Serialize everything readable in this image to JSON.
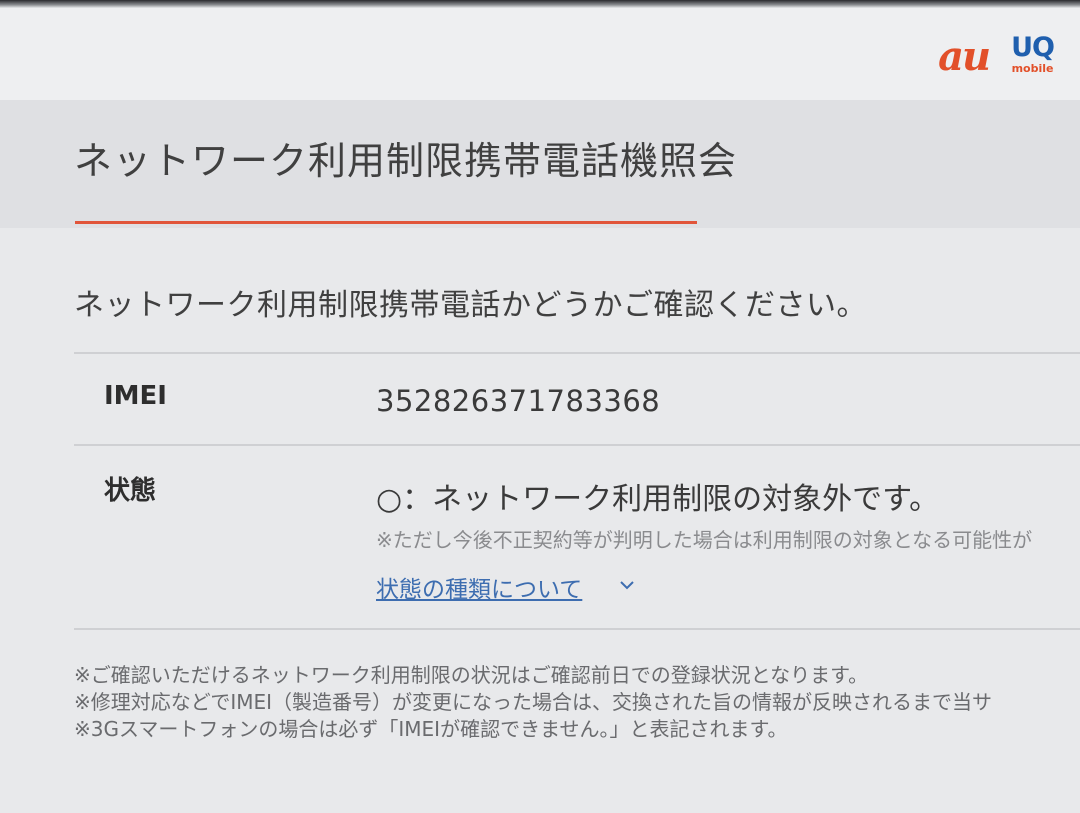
{
  "brand": {
    "au_logo": "au",
    "uq_logo_main": "UQ",
    "uq_logo_sub": "mobile",
    "accent_color": "#e2502a",
    "uq_color": "#1f5fae"
  },
  "page": {
    "title": "ネットワーク利用制限携帯電話機照会",
    "lead": "ネットワーク利用制限携帯電話かどうかご確認ください。"
  },
  "result": {
    "imei_label": "IMEI",
    "imei_value": "352826371783368",
    "status_label": "状態",
    "status_value": "○：ネットワーク利用制限の対象外です。",
    "status_note": "※ただし今後不正契約等が判明した場合は利用制限の対象となる可能性が",
    "status_link": "状態の種類について",
    "status_link_icon": "chevron-down-icon"
  },
  "footnotes": [
    "※ご確認いただけるネットワーク利用制限の状況はご確認前日での登録状況となります。",
    "※修理対応などでIMEI（製造番号）が変更になった場合は、交換された旨の情報が反映されるまで当サ",
    "※3Gスマートフォンの場合は必ず「IMEIが確認できません。」と表記されます。"
  ]
}
